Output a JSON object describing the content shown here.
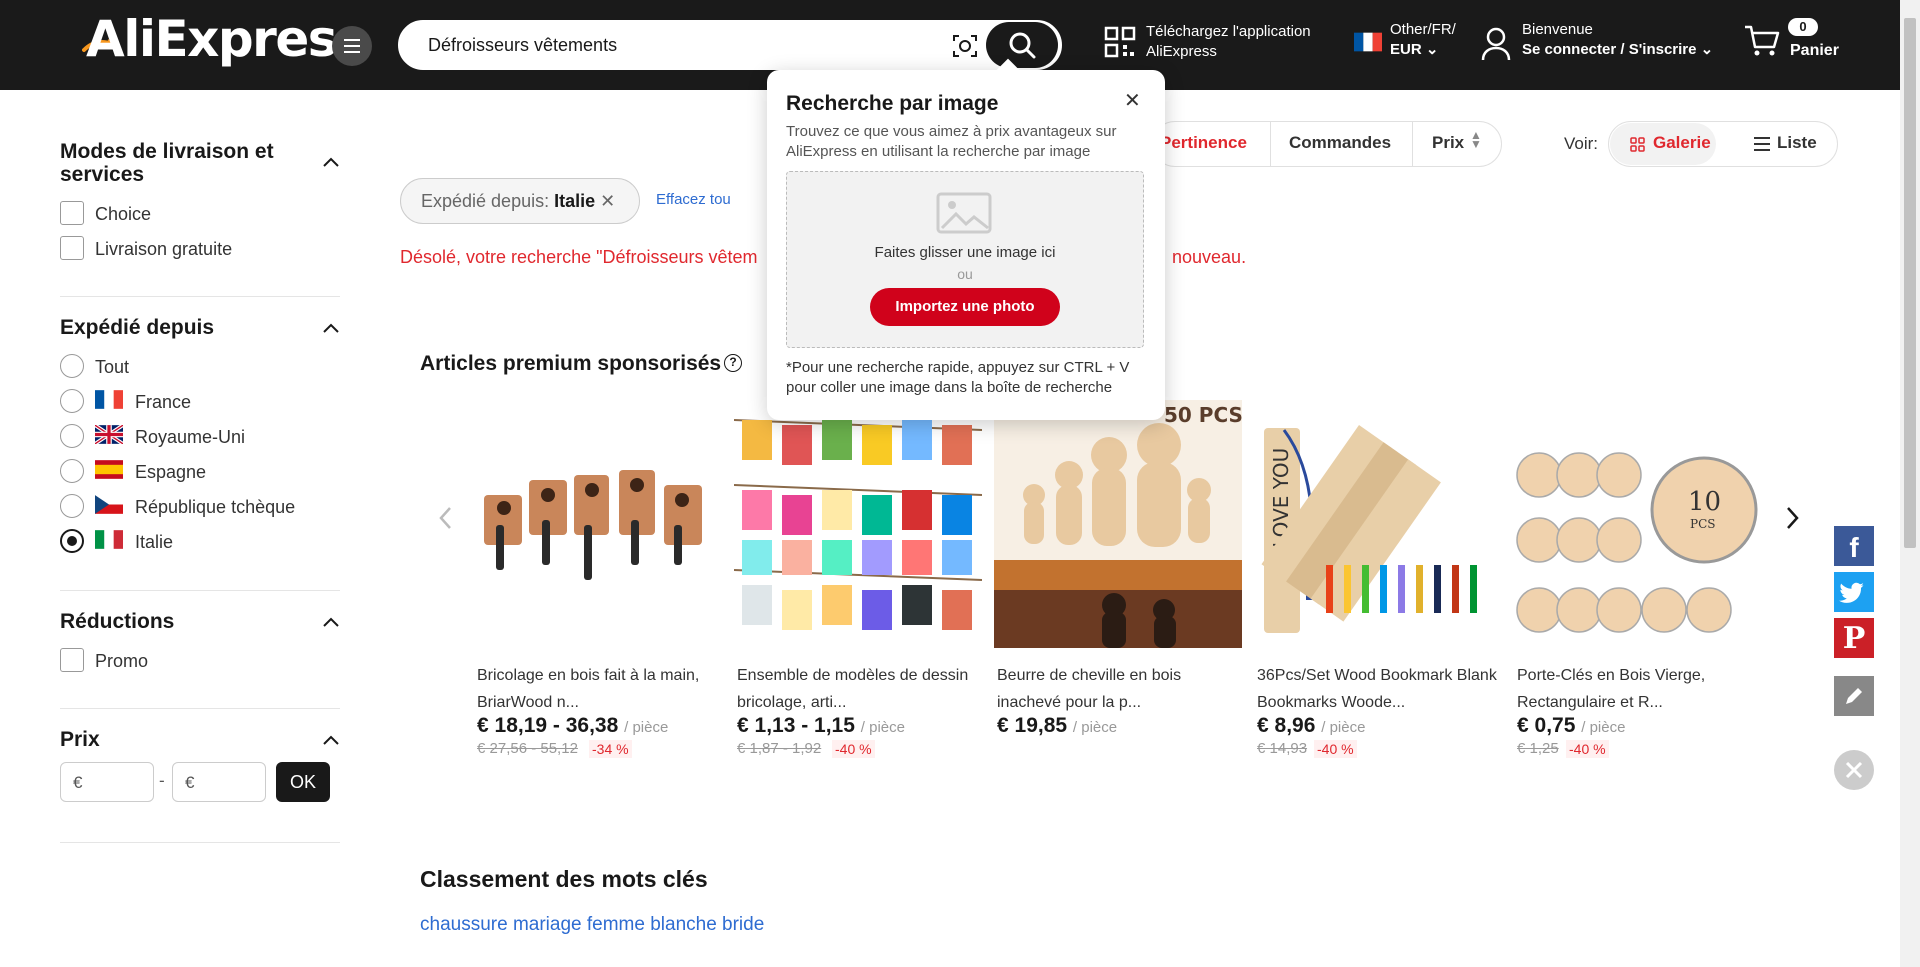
{
  "header": {
    "logo": "AliExpress",
    "search_value": "Défroisseurs vêtements",
    "app_line1": "Téléchargez l'application",
    "app_line2": "AliExpress",
    "locale_line1": "Other/FR/",
    "locale_line2": "EUR",
    "welcome_line1": "Bienvenue",
    "welcome_line2": "Se connecter / S'inscrire",
    "cart_count": "0",
    "cart_label": "Panier",
    "bg_color": "#1a1a1a"
  },
  "sidebar": {
    "delivery": {
      "title": "Modes de livraison et services",
      "options": [
        "Choice",
        "Livraison gratuite"
      ]
    },
    "ship_from": {
      "title": "Expédié depuis",
      "options": [
        "Tout",
        "France",
        "Royaume-Uni",
        "Espagne",
        "République tchèque",
        "Italie"
      ],
      "selected": "Italie"
    },
    "reductions": {
      "title": "Réductions",
      "options": [
        "Promo"
      ]
    },
    "price": {
      "title": "Prix",
      "min_placeholder": "€",
      "max_placeholder": "€",
      "separator": "-",
      "ok": "OK"
    }
  },
  "sort": {
    "relevance": "Pertinence",
    "orders": "Commandes",
    "price": "Prix",
    "voir": "Voir:",
    "gallery": "Galerie",
    "list": "Liste",
    "active_color": "#e0282e"
  },
  "filters": {
    "chip_label": "Expédié depuis:",
    "chip_value": "Italie",
    "clear": "Effacez tou"
  },
  "message": {
    "left": "Désolé, votre recherche \"Défroisseurs vêtem",
    "right": "nouveau."
  },
  "premium": {
    "title": "Articles premium sponsorisés",
    "items": [
      {
        "title1": "Bricolage en bois fait à la main,",
        "title2": "BriarWood n...",
        "price": "€ 18,19 - 36,38",
        "unit": "/ pièce",
        "old": "€ 27,56 - 55,12",
        "discount": "-34 %"
      },
      {
        "title1": "Ensemble de modèles de dessin",
        "title2": "bricolage, arti...",
        "price": "€ 1,13 - 1,15",
        "unit": "/ pièce",
        "old": "€ 1,87 - 1,92",
        "discount": "-40 %"
      },
      {
        "title1": "Beurre de cheville en bois",
        "title2": "inachevé pour la p...",
        "price": "€ 19,85",
        "unit": "/ pièce",
        "old": "",
        "discount": ""
      },
      {
        "title1": "36Pcs/Set Wood Bookmark Blank",
        "title2": "Bookmarks Woode...",
        "price": "€ 8,96",
        "unit": "/ pièce",
        "old": "€ 14,93",
        "discount": "-40 %"
      },
      {
        "title1": "Porte-Clés en Bois Vierge,",
        "title2": "Rectangulaire et R...",
        "price": "€ 0,75",
        "unit": "/ pièce",
        "old": "€ 1,25",
        "discount": "-40 %"
      }
    ],
    "img_text_1": "50 PCS",
    "img_text_2": "I LOVE YOU",
    "img_text_3": "10",
    "img_text_4": "PCS"
  },
  "keywords": {
    "title": "Classement des mots clés",
    "link": "chaussure mariage femme blanche bride"
  },
  "popup": {
    "title": "Recherche par image",
    "desc": "Trouvez ce que vous aimez à prix avantageux sur AliExpress en utilisant la recherche par image",
    "drop": "Faites glisser une image ici",
    "or": "ou",
    "upload": "Importez une photo",
    "hint": "*Pour une recherche rapide, appuyez sur CTRL + V pour coller une image dans la boîte de recherche"
  },
  "icons": [
    "menu-icon",
    "camera-icon",
    "search-icon",
    "qr-icon",
    "user-icon",
    "cart-icon",
    "facebook-icon",
    "twitter-icon",
    "pinterest-icon",
    "edit-icon",
    "close-icon",
    "image-icon"
  ]
}
